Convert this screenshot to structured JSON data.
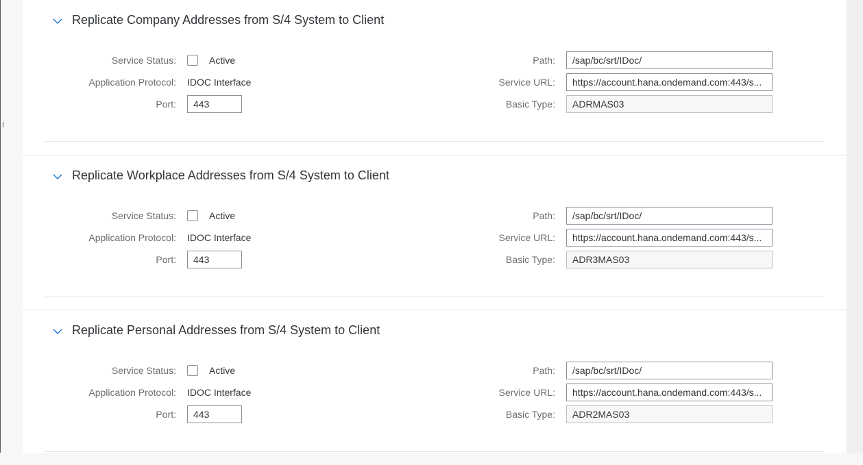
{
  "sections": [
    {
      "title": "Replicate Company Addresses from S/4 System to Client",
      "service_status_label": "Service Status:",
      "active_label": "Active",
      "app_protocol_label": "Application Protocol:",
      "app_protocol_value": "IDOC Interface",
      "port_label": "Port:",
      "port_value": "443",
      "path_label": "Path:",
      "path_value": "/sap/bc/srt/IDoc/",
      "service_url_label": "Service URL:",
      "service_url_value": "https://account.hana.ondemand.com:443/s...",
      "basic_type_label": "Basic Type:",
      "basic_type_value": "ADRMAS03"
    },
    {
      "title": "Replicate Workplace Addresses from S/4 System to Client",
      "service_status_label": "Service Status:",
      "active_label": "Active",
      "app_protocol_label": "Application Protocol:",
      "app_protocol_value": "IDOC Interface",
      "port_label": "Port:",
      "port_value": "443",
      "path_label": "Path:",
      "path_value": "/sap/bc/srt/IDoc/",
      "service_url_label": "Service URL:",
      "service_url_value": "https://account.hana.ondemand.com:443/s...",
      "basic_type_label": "Basic Type:",
      "basic_type_value": "ADR3MAS03"
    },
    {
      "title": "Replicate Personal Addresses from S/4 System to Client",
      "service_status_label": "Service Status:",
      "active_label": "Active",
      "app_protocol_label": "Application Protocol:",
      "app_protocol_value": "IDOC Interface",
      "port_label": "Port:",
      "port_value": "443",
      "path_label": "Path:",
      "path_value": "/sap/bc/srt/IDoc/",
      "service_url_label": "Service URL:",
      "service_url_value": "https://account.hana.ondemand.com:443/s...",
      "basic_type_label": "Basic Type:",
      "basic_type_value": "ADR2MAS03"
    }
  ],
  "icons": {
    "chevron": "chevron-down-icon",
    "checkbox_checked": false
  },
  "colors": {
    "accent": "#0a6ed1",
    "text": "#32363a",
    "label": "#6a6d70"
  }
}
